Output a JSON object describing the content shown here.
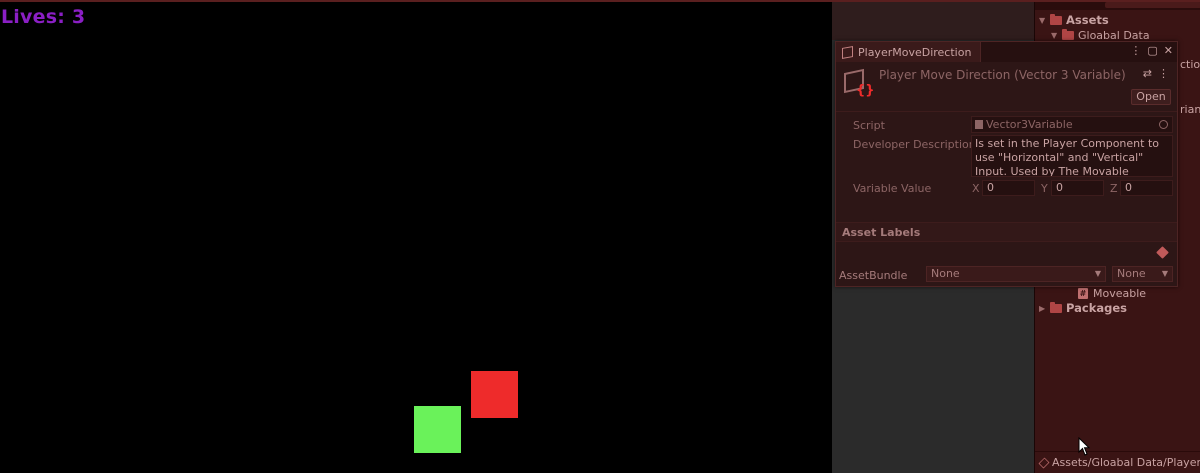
{
  "game": {
    "lives_text": "Lives: 3",
    "colors": {
      "lives": "#8a1fc4",
      "enemy": "#ee2b2b",
      "player": "#6af25a"
    }
  },
  "project": {
    "assets_label": "Assets",
    "gloabal_data_label": "Gloabal Data",
    "clip_ctio": "ctio",
    "clip_riant": "riant",
    "moveable_label": "Moveable",
    "packages_label": "Packages",
    "footer_path": "Assets/Gloabal Data/Player"
  },
  "inspector": {
    "tab_title": "PlayerMoveDirection",
    "title": "Player Move Direction (Vector 3 Variable)",
    "open_label": "Open",
    "script_label": "Script",
    "script_value": "Vector3Variable",
    "desc_label": "Developer Description",
    "desc_value": "Is set in the Player Component to use \"Horizontal\" and \"Vertical\" Input. Used by The Movable Component",
    "variable_label": "Variable Value",
    "x_label": "X",
    "x_value": "0",
    "y_label": "Y",
    "y_value": "0",
    "z_label": "Z",
    "z_value": "0",
    "asset_labels_header": "Asset Labels",
    "asset_bundle_label": "AssetBundle",
    "bundle_value": "None",
    "variant_value": "None"
  },
  "icons": {
    "menu": "⋮",
    "maximize": "▢",
    "close": "✕",
    "settings": "⇄",
    "more": "⋮",
    "caret": "▼",
    "arrow_down": "▼",
    "arrow_right": "▶"
  }
}
